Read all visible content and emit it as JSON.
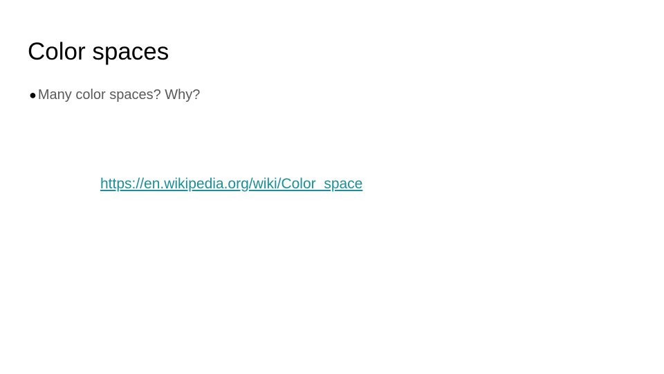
{
  "slide": {
    "title": "Color spaces",
    "bullets": [
      {
        "glyph": "●",
        "text": "Many color spaces? Why?"
      }
    ],
    "link": {
      "text": "https://en.wikipedia.org/wiki/Color_space",
      "href": "https://en.wikipedia.org/wiki/Color_space",
      "color": "#1a8f99"
    }
  }
}
